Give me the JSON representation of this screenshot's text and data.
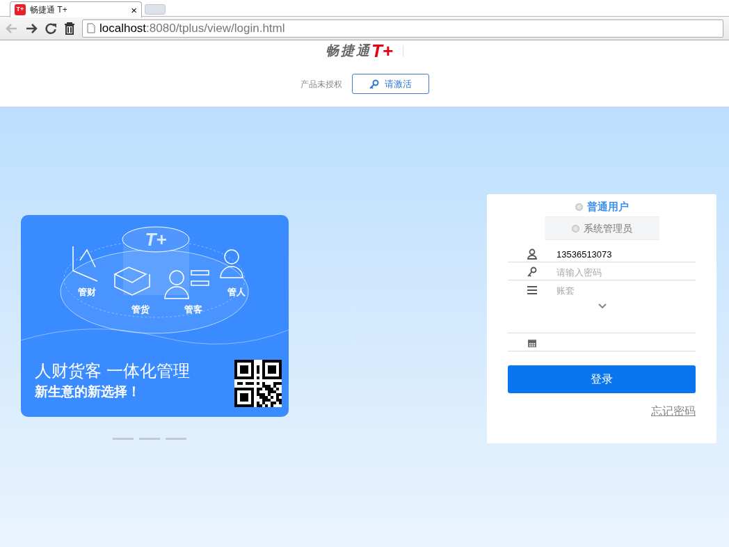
{
  "browser": {
    "tab_title": "畅捷通 T+",
    "tab_close": "×",
    "favicon_text": "T+",
    "url_host": "localhost",
    "url_path": ":8080/tplus/view/login.html"
  },
  "header": {
    "logo_text": "畅捷通",
    "logo_mark": "T+",
    "license_status": "产品未授权",
    "activate_button": "请激活"
  },
  "banner": {
    "headline": "人财货客 一体化管理",
    "tagline": "新生意的新选择！",
    "labels": [
      "管财",
      "管货",
      "管客",
      "管人"
    ],
    "logo_mark": "T+"
  },
  "login": {
    "user_types": [
      {
        "label": "普通用户",
        "selected": true
      },
      {
        "label": "系统管理员",
        "selected": false
      }
    ],
    "fields": [
      {
        "kind": "text",
        "value": "13536513073"
      },
      {
        "kind": "password",
        "placeholder": "请输入密码"
      },
      {
        "kind": "select",
        "placeholder": "账套"
      },
      {
        "kind": "date"
      }
    ],
    "submit": "登录",
    "forgot": "忘记密码"
  }
}
